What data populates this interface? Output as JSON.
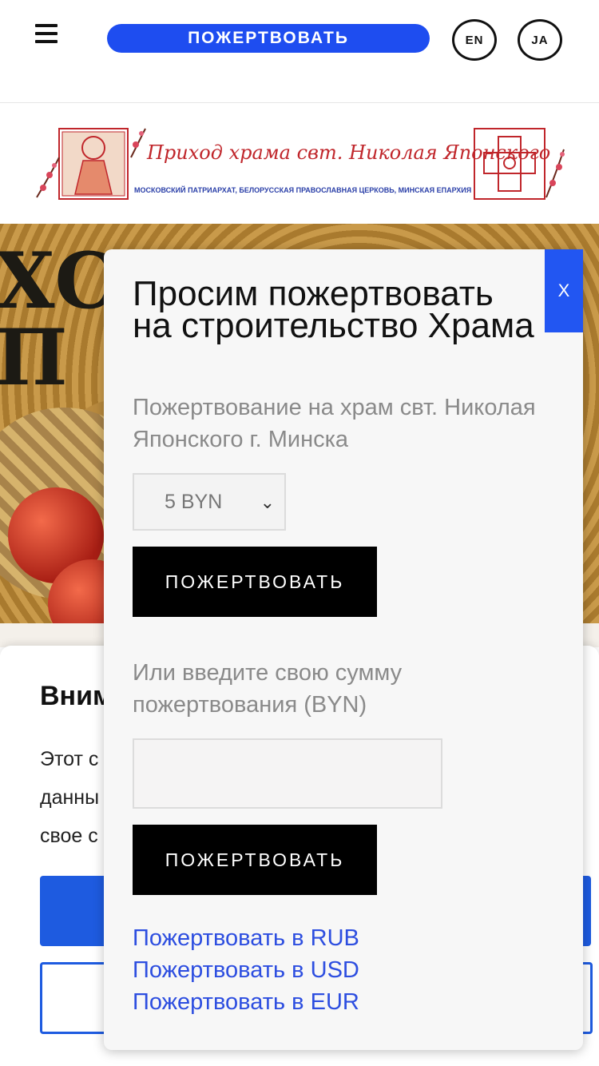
{
  "header": {
    "donate_label": "ПОЖЕРТВОВАТЬ",
    "lang_en": "EN",
    "lang_ja": "JA"
  },
  "logo": {
    "title": "Приход храма свт. Николая Японского",
    "subtitle": "МОСКОВСКИЙ ПАТРИАРХАТ, БЕЛОРУССКАЯ ПРАВОСЛАВНАЯ ЦЕРКОВЬ, МИНСКАЯ ЕПАРХИЯ"
  },
  "hero": {
    "text": "ХСПЯ\nП"
  },
  "notice": {
    "title": "Вним",
    "text": "Этот с\nданны\nсвое с"
  },
  "modal": {
    "close_label": "X",
    "title": "Просим пожертвовать на строительство Храма",
    "subtitle": "Пожертвование на храм свт. Николая Японского г. Минска",
    "amount_selected": "5 BYN",
    "donate_button": "ПОЖЕРТВОВАТЬ",
    "custom_label": "Или введите свою сумму пожертвования (BYN)",
    "custom_value": "",
    "donate_button_2": "ПОЖЕРТВОВАТЬ",
    "links": [
      "Пожертвовать в RUB",
      "Пожертвовать в USD",
      "Пожертвовать в EUR"
    ]
  },
  "colors": {
    "accent": "#1e4df0",
    "close_bg": "#2256f2",
    "link": "#2d4ee0"
  },
  "icons": [
    "menu-icon",
    "chevron-down-icon"
  ]
}
